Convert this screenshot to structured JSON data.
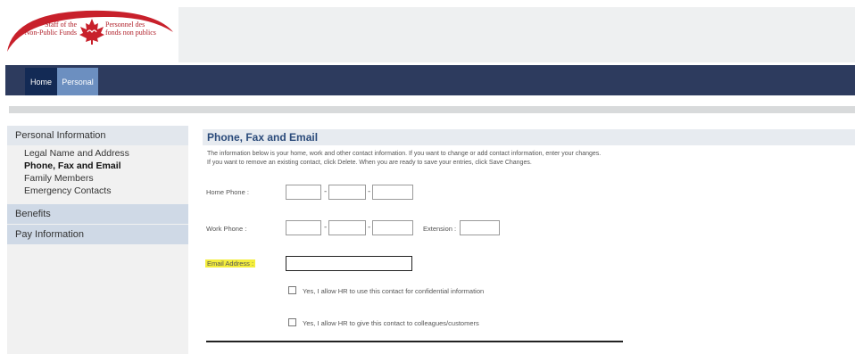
{
  "brand": {
    "name_en": "Staff of the Non-Public Funds",
    "name_en_line1": "Staff of the",
    "name_en_line2": "Non-Public Funds",
    "name_fr_line1": "Personnel des",
    "name_fr_line2": "fonds non publics",
    "colors": {
      "red": "#c8202b",
      "nav": "#2d3b5e",
      "tab_active": "#6c8fc0",
      "highlight": "#f4ee3c"
    }
  },
  "nav": {
    "tabs": [
      {
        "label": "Home",
        "icon": ""
      },
      {
        "label": "Personal",
        "icon": ""
      }
    ]
  },
  "sidebar": {
    "sections": [
      {
        "label": "Personal Information"
      },
      {
        "label": "Benefits"
      },
      {
        "label": "Pay Information"
      }
    ],
    "items": [
      {
        "label": "Legal Name and Address"
      },
      {
        "label": "Phone, Fax and Email"
      },
      {
        "label": "Family Members"
      },
      {
        "label": "Emergency Contacts"
      }
    ]
  },
  "main": {
    "title": "Phone, Fax and Email",
    "description_1": "The information below is your home, work and other contact information. If you want to change or add contact information, enter your changes.",
    "description_2": "If you want to remove an existing contact, click Delete. When you are ready to save your entries, click Save Changes.",
    "home_phone_label": "Home Phone :",
    "work_phone_label": "Work Phone :",
    "extension_label": "Extension :",
    "email_label": "Email Address :",
    "dash": "-",
    "checkbox_1_label": "Yes, I allow HR to use this contact for confidential information",
    "checkbox_2_label": "Yes, I allow HR to give this contact to colleagues/customers",
    "home_phone": {
      "area": "",
      "prefix": "",
      "line": ""
    },
    "work_phone": {
      "area": "",
      "prefix": "",
      "line": "",
      "extension": ""
    },
    "email": ""
  }
}
